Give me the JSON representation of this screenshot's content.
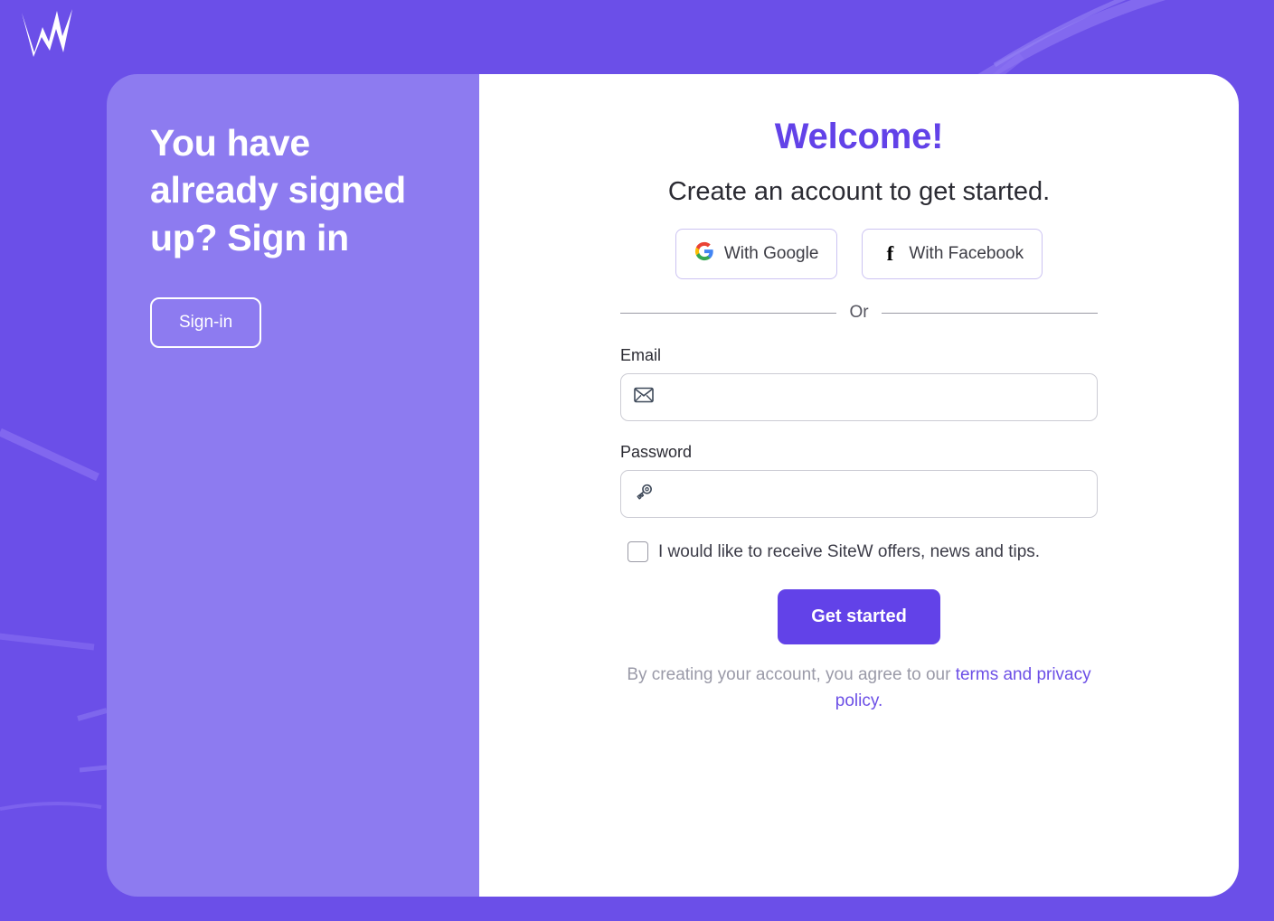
{
  "brand": {
    "logo_icon": "sitew-w-logo-icon",
    "name": "SiteW"
  },
  "colors": {
    "background_purple": "#6b4fe8",
    "left_panel_purple": "#8d7bf0",
    "accent_purple": "#6242e8",
    "link_purple": "#6c4fe6",
    "card_white": "#ffffff"
  },
  "left_panel": {
    "heading": "You have already signed up? Sign in",
    "signin_button_label": "Sign-in"
  },
  "right_panel": {
    "title": "Welcome!",
    "subtitle": "Create an account to get started.",
    "social": {
      "google": {
        "label": "With Google",
        "icon": "google-g-icon"
      },
      "facebook": {
        "label": "With Facebook",
        "icon": "facebook-f-icon",
        "glyph": "f"
      }
    },
    "divider_text": "Or",
    "fields": {
      "email": {
        "label": "Email",
        "value": "",
        "placeholder": "",
        "icon": "envelope-icon"
      },
      "password": {
        "label": "Password",
        "value": "",
        "placeholder": "",
        "icon": "key-icon"
      }
    },
    "newsletter": {
      "label": "I would like to receive SiteW offers, news and tips.",
      "checked": false
    },
    "submit_label": "Get started",
    "terms": {
      "prefix": "By creating your account, you agree to our ",
      "link": "terms and privacy policy",
      "suffix": "."
    }
  }
}
